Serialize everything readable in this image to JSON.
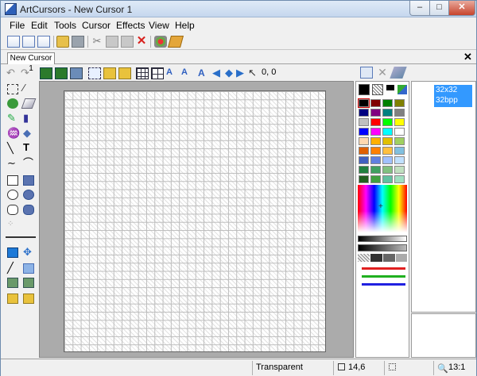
{
  "window": {
    "title": "ArtCursors - New Cursor 1",
    "minimize": "–",
    "maximize": "□",
    "close": "✕"
  },
  "menu": [
    "File",
    "Edit",
    "Tools",
    "Cursor",
    "Effects",
    "View",
    "Help"
  ],
  "tab": {
    "label": "New Cursor 1",
    "close": "✕"
  },
  "coords": "0, 0",
  "sizes": {
    "size": "32x32",
    "depth": "32bpp"
  },
  "status": {
    "mode": "Transparent",
    "position": "14,6",
    "zoom": "13:1"
  },
  "colors": {
    "accent": "#3399ff",
    "canvas_bg": "#ababab",
    "grid_line": "#bdbdbd"
  }
}
